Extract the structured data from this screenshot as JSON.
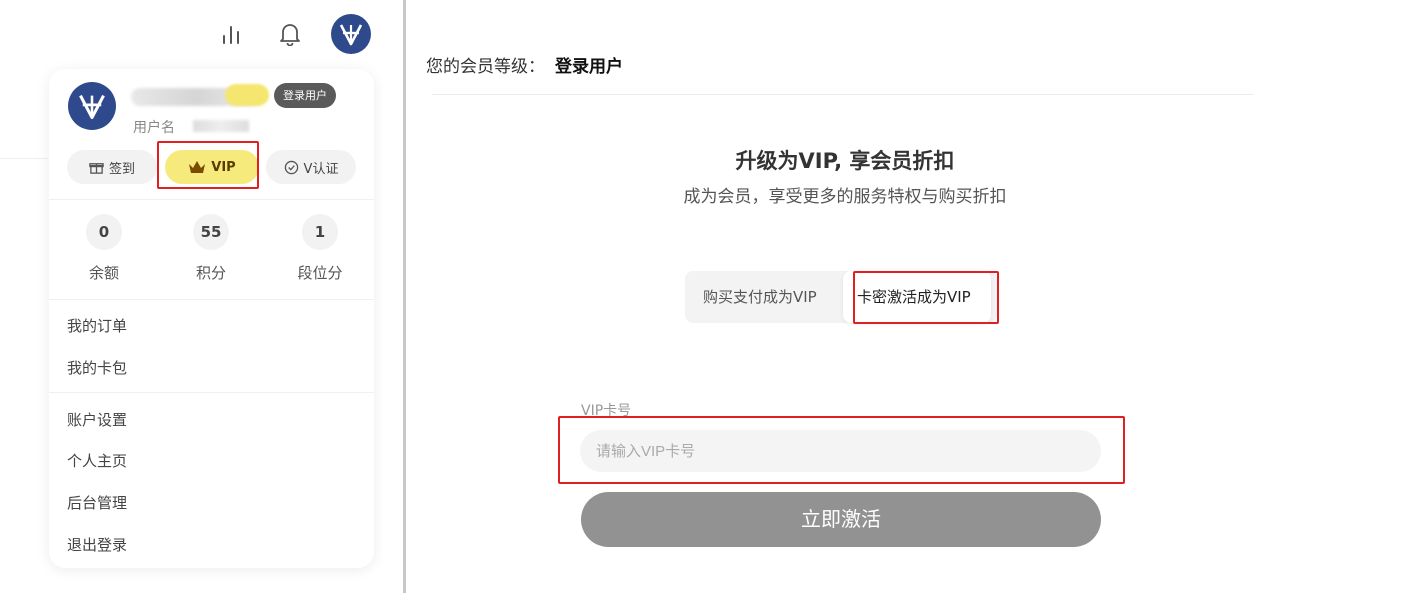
{
  "top_icons": {
    "stats": "bar-chart-icon",
    "notifications": "bell-icon",
    "avatar": "brand-v-logo"
  },
  "user_card": {
    "role_badge": "登录用户",
    "username_label": "用户名",
    "actions": [
      {
        "label": "签到",
        "icon": "gift-icon"
      },
      {
        "label": "VIP",
        "icon": "crown-icon"
      },
      {
        "label": "V认证",
        "icon": "verified-icon"
      }
    ],
    "stats": [
      {
        "value": "0",
        "label": "余额"
      },
      {
        "value": "55",
        "label": "积分"
      },
      {
        "value": "1",
        "label": "段位分"
      }
    ],
    "menu_group1": [
      "我的订单",
      "我的卡包"
    ],
    "menu_group2": [
      "账户设置",
      "个人主页",
      "后台管理",
      "退出登录"
    ]
  },
  "main": {
    "level_label": "您的会员等级：",
    "level_value": "登录用户",
    "upgrade_title": "升级为VIP, 享会员折扣",
    "upgrade_subtitle": "成为会员，享受更多的服务特权与购买折扣",
    "tabs": [
      "购买支付成为VIP",
      "卡密激活成为VIP"
    ],
    "card_field_label": "VIP卡号",
    "card_field_placeholder": "请输入VIP卡号",
    "card_field_value": "",
    "activate_button": "立即激活"
  },
  "colors": {
    "accent_blue": "#2e4a8c",
    "vip_yellow": "#f7ea7c",
    "highlight_red": "#e02020",
    "button_gray": "#929292"
  }
}
